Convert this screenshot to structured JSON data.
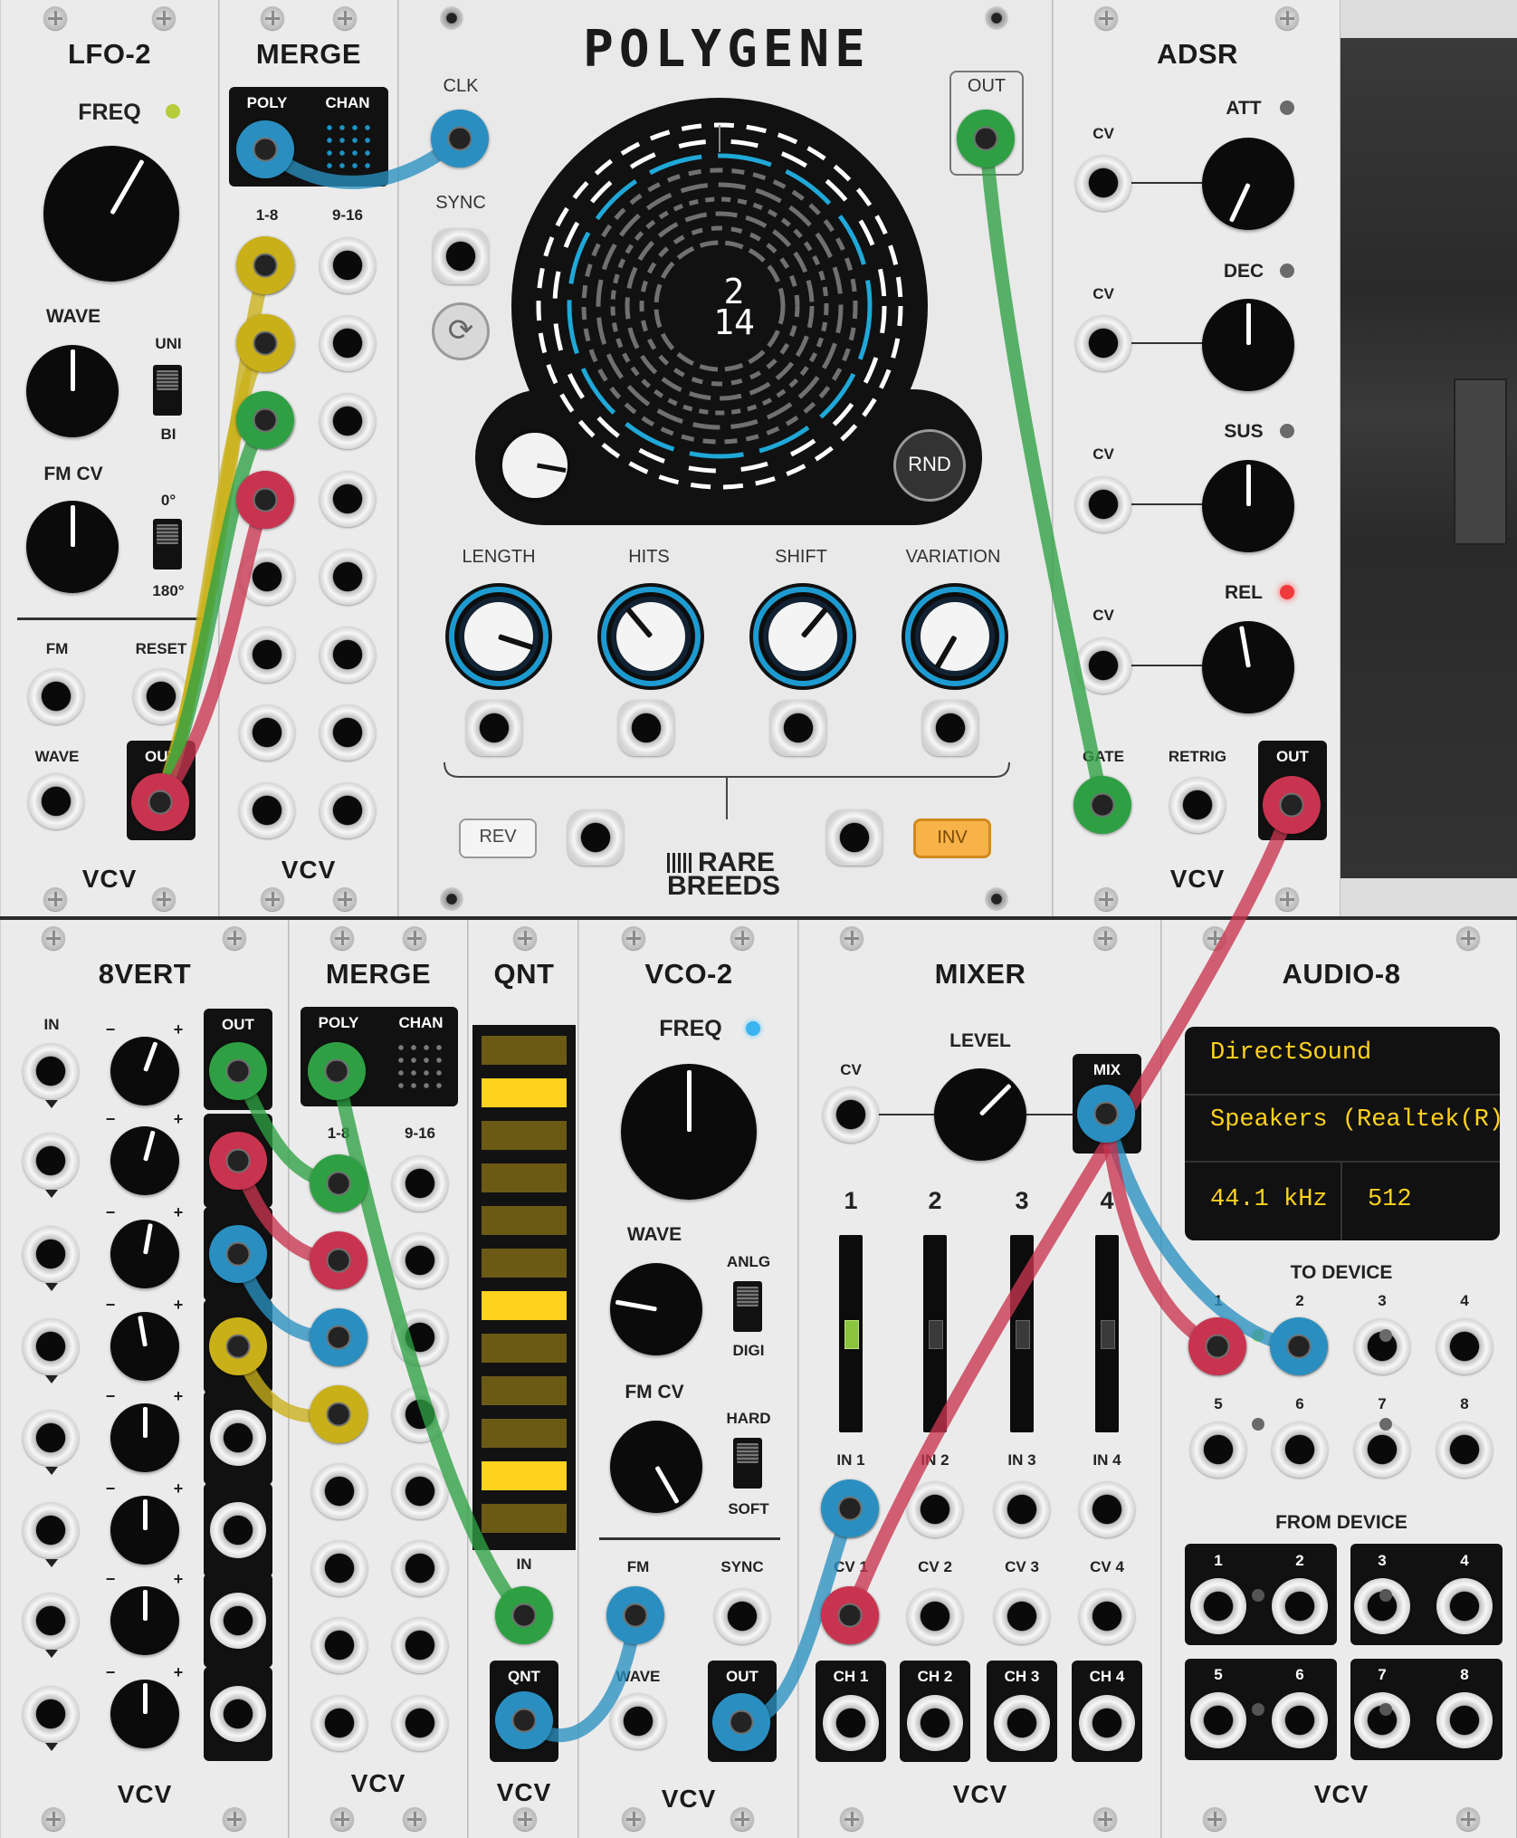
{
  "modules": {
    "lfo2": {
      "title": "LFO-2",
      "freq": "FREQ",
      "wave": "WAVE",
      "fm_cv": "FM CV",
      "uni": "UNI",
      "bi": "BI",
      "deg0": "0°",
      "deg180": "180°",
      "fm": "FM",
      "reset": "RESET",
      "wave_in": "WAVE",
      "out": "OUT",
      "brand": "VCV"
    },
    "merge_top": {
      "title": "MERGE",
      "poly": "POLY",
      "chan": "CHAN",
      "in_1_8": "1-8",
      "in_9_16": "9-16",
      "brand": "VCV"
    },
    "polygene": {
      "title": "POLYGENE",
      "clk": "CLK",
      "sync": "SYNC",
      "out": "OUT",
      "display_top": "2",
      "display_bottom": "14",
      "rnd": "RND",
      "length": "LENGTH",
      "hits": "HITS",
      "shift": "SHIFT",
      "variation": "VARIATION",
      "rev": "REV",
      "inv": "INV",
      "brand_line1": "RARE",
      "brand_line2": "BREEDS"
    },
    "adsr": {
      "title": "ADSR",
      "att": "ATT",
      "dec": "DEC",
      "sus": "SUS",
      "rel": "REL",
      "cv": "CV",
      "gate": "GATE",
      "retrig": "RETRIG",
      "out": "OUT",
      "brand": "VCV"
    },
    "eightvert": {
      "title": "8VERT",
      "in": "IN",
      "out": "OUT",
      "minus": "−",
      "plus": "+",
      "brand": "VCV"
    },
    "merge_bottom": {
      "title": "MERGE",
      "poly": "POLY",
      "chan": "CHAN",
      "in_1_8": "1-8",
      "in_9_16": "9-16",
      "brand": "VCV"
    },
    "qnt": {
      "title": "QNT",
      "in": "IN",
      "out": "QNT",
      "brand": "VCV",
      "notes_active": [
        false,
        true,
        false,
        false,
        false,
        false,
        true,
        false,
        false,
        false,
        true,
        false
      ]
    },
    "vco2": {
      "title": "VCO-2",
      "freq": "FREQ",
      "wave": "WAVE",
      "anlg": "ANLG",
      "digi": "DIGI",
      "fm_cv": "FM CV",
      "hard": "HARD",
      "soft": "SOFT",
      "fm": "FM",
      "sync": "SYNC",
      "wave_in": "WAVE",
      "out": "OUT",
      "brand": "VCV"
    },
    "mixer": {
      "title": "MIXER",
      "level": "LEVEL",
      "cv": "CV",
      "mix": "MIX",
      "channels": [
        "1",
        "2",
        "3",
        "4"
      ],
      "inputs": [
        "IN 1",
        "IN 2",
        "IN 3",
        "IN 4"
      ],
      "cvs": [
        "CV 1",
        "CV 2",
        "CV 3",
        "CV 4"
      ],
      "outs": [
        "CH 1",
        "CH 2",
        "CH 3",
        "CH 4"
      ],
      "fader_levels": [
        0.5,
        0.5,
        0.5,
        0.5
      ],
      "brand": "VCV"
    },
    "audio8": {
      "title": "AUDIO-8",
      "driver": "DirectSound",
      "device": "Speakers (Realtek(R)",
      "sample_rate": "44.1 kHz",
      "block_size": "512",
      "to_device": "TO DEVICE",
      "from_device": "FROM DEVICE",
      "to_labels": [
        "1",
        "2",
        "3",
        "4",
        "5",
        "6",
        "7",
        "8"
      ],
      "from_labels": [
        "1",
        "2",
        "3",
        "4",
        "5",
        "6",
        "7",
        "8"
      ],
      "brand": "VCV"
    }
  },
  "colors": {
    "panel": "#ebebeb",
    "cable_green": "#2ea043",
    "cable_red": "#c8344f",
    "cable_blue": "#2a8fc0",
    "cable_yellow": "#c9b018",
    "polygene_accent": "#1fa8d8",
    "display_text": "#ffd21f"
  }
}
